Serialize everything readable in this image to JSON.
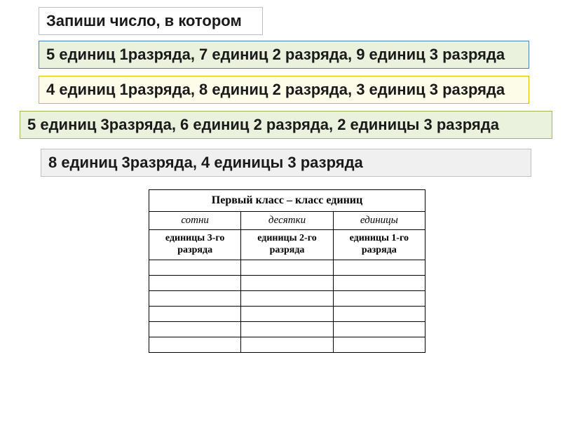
{
  "title": "Запиши число, в котором",
  "lines": {
    "blue": "5 единиц 1разряда, 7 единиц 2 разряда, 9 единиц 3 разряда",
    "yellow": "4 единиц 1разряда, 8 единиц 2 разряда, 3 единиц 3 разряда",
    "green": "5 единиц 3разряда, 6 единиц 2 разряда, 2 единицы  3 разряда",
    "gray": "8 единиц 3разряда, 4 единицы 3 разряда"
  },
  "table": {
    "header_title": "Первый класс – класс единиц",
    "subheaders": [
      "сотни",
      "десятки",
      "единицы"
    ],
    "unitheaders": [
      "единицы 3-го разряда",
      "единицы 2-го разряда",
      "единицы 1-го разряда"
    ],
    "empty_row_count": 6
  }
}
